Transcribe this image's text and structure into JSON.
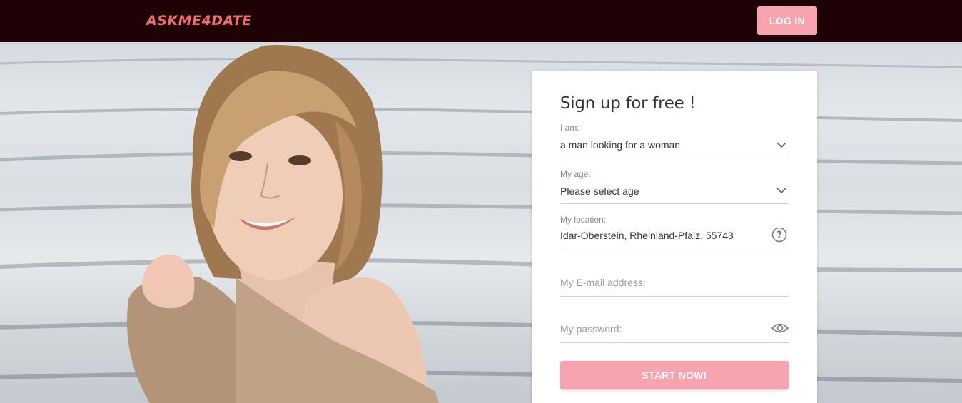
{
  "header": {
    "logo": "ASKME4DATE",
    "login_label": "LOG IN"
  },
  "hero": {
    "image": "smiling-woman-photo"
  },
  "signup": {
    "title": "Sign up for free !",
    "iam": {
      "label": "I am:",
      "value": "a man looking for a woman"
    },
    "age": {
      "label": "My age:",
      "value": "Please select age"
    },
    "location": {
      "label": "My location:",
      "value": "Idar-Oberstein, Rheinland-Pfalz, 55743"
    },
    "email": {
      "placeholder": "My E-mail address:"
    },
    "password": {
      "placeholder": "My password:"
    },
    "start_label": "START NOW!"
  },
  "colors": {
    "topbar": "#1e0206",
    "brand": "#f06b6e",
    "button": "#f7a3b0"
  }
}
